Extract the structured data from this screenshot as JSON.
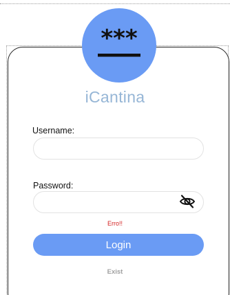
{
  "app": {
    "title": "iCantina",
    "logo_icon": "password-asterisks-icon",
    "logo_text": "***",
    "accent_color": "#6a9bf4",
    "title_color": "#96b6d6"
  },
  "form": {
    "username_label": "Username:",
    "username_value": "",
    "password_label": "Password:",
    "password_value": "",
    "password_toggle_icon": "eye-slash-icon",
    "error_text": "Erro!!",
    "error_color": "#d32020",
    "login_label": "Login",
    "exit_label": "Exist"
  }
}
